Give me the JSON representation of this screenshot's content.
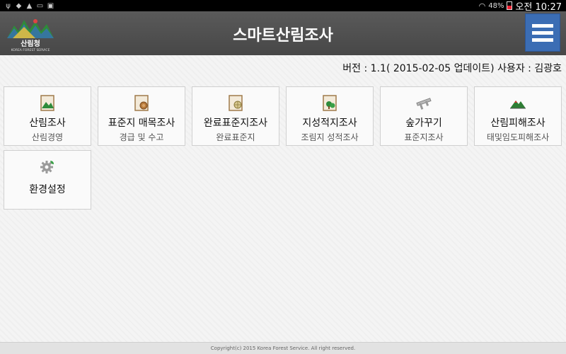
{
  "status_bar": {
    "battery": "48%",
    "time": "오전 10:27",
    "left_icons": [
      "usb-icon",
      "shield-icon",
      "warning-icon",
      "notification-icon",
      "shopping-icon"
    ]
  },
  "header": {
    "logo_text": "산림청",
    "logo_subtext": "KOREA FOREST SERVICE",
    "title": "스마트산림조사",
    "menu_icon": "hamburger-icon",
    "accent": "#3b6db4"
  },
  "info": {
    "text": "버전 : 1.1( 2015-02-05 업데이트) 사용자 : 김광호"
  },
  "tiles": [
    {
      "title": "산림조사",
      "subtitle": "산림경영",
      "icon": "forest-clipboard-icon"
    },
    {
      "title": "표준지 매목조사",
      "subtitle": "경급 및 수고",
      "icon": "wood-clipboard-icon"
    },
    {
      "title": "완료표준지조사",
      "subtitle": "완료표준지",
      "icon": "globe-clipboard-icon"
    },
    {
      "title": "지성적지조사",
      "subtitle": "조림지 성적조사",
      "icon": "tree-clipboard-icon"
    },
    {
      "title": "숲가꾸기",
      "subtitle": "표준지조사",
      "icon": "caliper-icon"
    },
    {
      "title": "산림피해조사",
      "subtitle": "태및임도피해조사",
      "icon": "mountain-icon"
    },
    {
      "title": "환경설정",
      "subtitle": "",
      "icon": "gear-icon"
    }
  ],
  "footer": {
    "copyright": "Copyright(c) 2015 Korea Forest Service. All right reserved."
  }
}
